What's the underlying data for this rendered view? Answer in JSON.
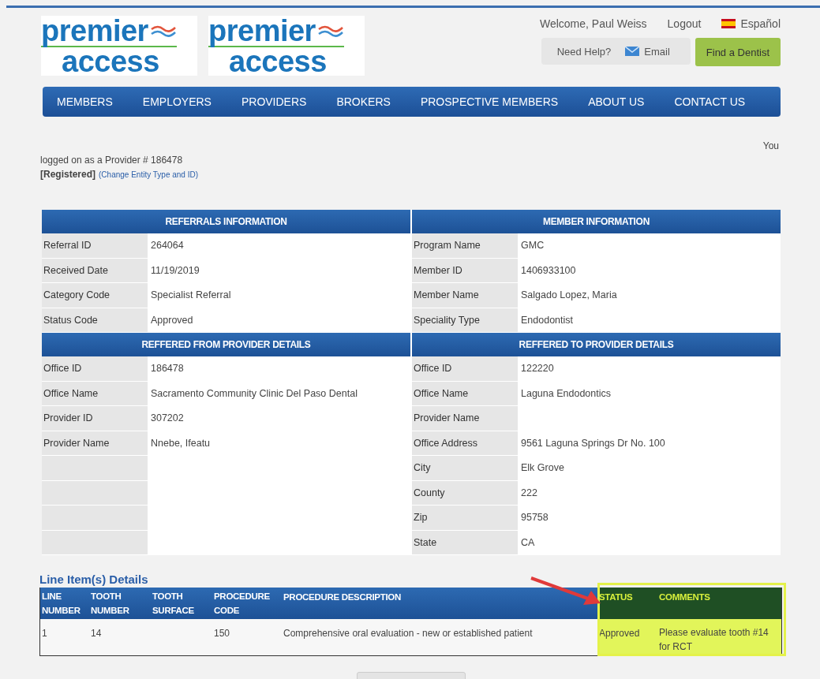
{
  "logos": [
    {
      "line1": "premier",
      "line2": "access"
    },
    {
      "line1": "premier",
      "line2": "access"
    }
  ],
  "top_links": {
    "welcome": "Welcome, Paul Weiss",
    "logout": "Logout",
    "language": "Español"
  },
  "help": {
    "label": "Need Help?",
    "email": "Email"
  },
  "find_button": "Find a Dentist",
  "nav": [
    "MEMBERS",
    "EMPLOYERS",
    "PROVIDERS",
    "BROKERS",
    "PROSPECTIVE MEMBERS",
    "ABOUT US",
    "CONTACT US"
  ],
  "login_info": {
    "you": "You",
    "logged": "logged on as a Provider # 186478",
    "registered": "[Registered]",
    "change_link": "(Change Entity Type and ID)"
  },
  "sections": [
    {
      "left": {
        "title": "REFERRALS INFORMATION",
        "rows": [
          {
            "label": "Referral ID",
            "value": "264064"
          },
          {
            "label": "Received Date",
            "value": "11/19/2019"
          },
          {
            "label": "Category Code",
            "value": "Specialist Referral"
          },
          {
            "label": "Status Code",
            "value": "Approved"
          }
        ]
      },
      "right": {
        "title": "MEMBER INFORMATION",
        "rows": [
          {
            "label": "Program Name",
            "value": "GMC"
          },
          {
            "label": "Member ID",
            "value": "1406933100"
          },
          {
            "label": "Member Name",
            "value": "Salgado Lopez, Maria"
          },
          {
            "label": "Speciality Type",
            "value": "Endodontist"
          }
        ]
      }
    },
    {
      "left": {
        "title": "REFFERED FROM PROVIDER DETAILS",
        "rows": [
          {
            "label": "Office ID",
            "value": "186478"
          },
          {
            "label": "Office Name",
            "value": "Sacramento Community Clinic Del Paso Dental"
          },
          {
            "label": "Provider ID",
            "value": "307202"
          },
          {
            "label": "Provider Name",
            "value": "Nnebe, Ifeatu"
          },
          {},
          {},
          {},
          {}
        ]
      },
      "right": {
        "title": "REFFERED TO PROVIDER DETAILS",
        "rows": [
          {
            "label": "Office ID",
            "value": "122220"
          },
          {
            "label": "Office Name",
            "value": "Laguna Endodontics"
          },
          {
            "label": "Provider Name"
          },
          {
            "label": "Office Address",
            "value": "9561 Laguna Springs Dr No. 100"
          },
          {
            "label": "City",
            "value": "Elk Grove"
          },
          {
            "label": "County",
            "value": "222"
          },
          {
            "label": "Zip",
            "value": "95758"
          },
          {
            "label": "State",
            "value": "CA"
          }
        ]
      }
    }
  ],
  "line_items": {
    "title": "Line Item(s) Details",
    "columns": [
      {
        "label": "LINE NUMBER",
        "highlighted": false
      },
      {
        "label": "TOOTH NUMBER",
        "highlighted": false
      },
      {
        "label": "TOOTH SURFACE",
        "highlighted": false
      },
      {
        "label": "PROCEDURE CODE",
        "highlighted": false
      },
      {
        "label": "PROCEDURE DESCRIPTION",
        "highlighted": false
      },
      {
        "label": "STATUS",
        "highlighted": true
      },
      {
        "label": "COMMENTS",
        "highlighted": true
      }
    ],
    "rows": [
      [
        "1",
        "14",
        "",
        "150",
        "Comprehensive oral evaluation - new or established patient",
        "Approved",
        "Please evaluate tooth #14 for RCT"
      ]
    ]
  }
}
